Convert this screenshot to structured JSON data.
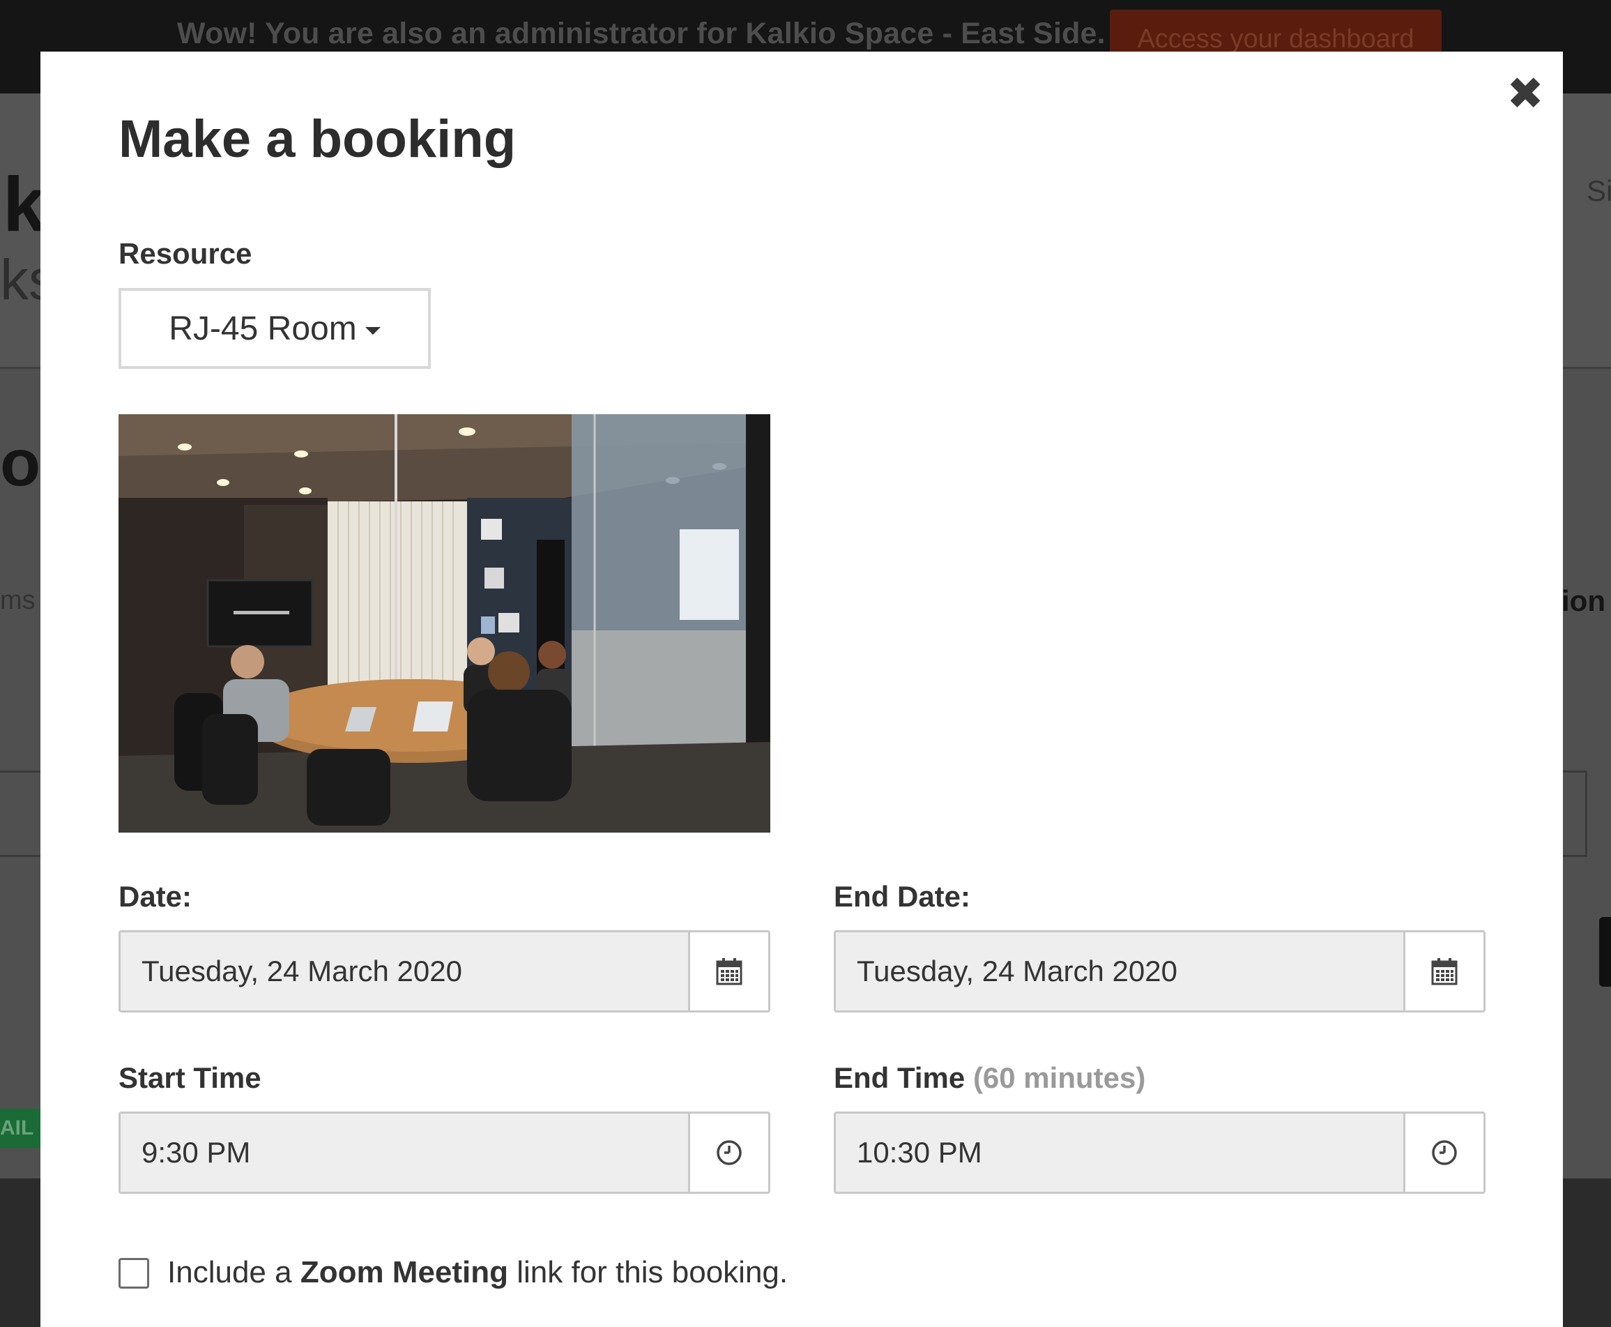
{
  "background": {
    "banner_message": "Wow! You are also an administrator for Kalkio Space - East Side.",
    "banner_button": "Access your dashboard",
    "fragment_k": "k",
    "fragment_ks": "ks",
    "fragment_o": "o",
    "fragment_ms": "ms",
    "fragment_ail": "AIL",
    "fragment_si": "Si",
    "fragment_ion": "ion"
  },
  "modal": {
    "title": "Make a booking",
    "close_symbol": "✖",
    "resource": {
      "label": "Resource",
      "selected": "RJ-45 Room"
    },
    "date": {
      "label": "Date:",
      "value": "Tuesday, 24 March 2020"
    },
    "end_date": {
      "label": "End Date:",
      "value": "Tuesday, 24 March 2020"
    },
    "start_time": {
      "label": "Start Time",
      "value": "9:30 PM"
    },
    "end_time": {
      "label": "End Time",
      "hint": "(60 minutes)",
      "value": "10:30 PM"
    },
    "zoom": {
      "prefix": "Include a ",
      "bold": "Zoom Meeting",
      "suffix": " link for this booking.",
      "checked": false
    }
  },
  "icons": {
    "calendar": "calendar-icon",
    "clock": "clock-icon",
    "close": "close-icon",
    "caret": "caret-down-icon"
  }
}
